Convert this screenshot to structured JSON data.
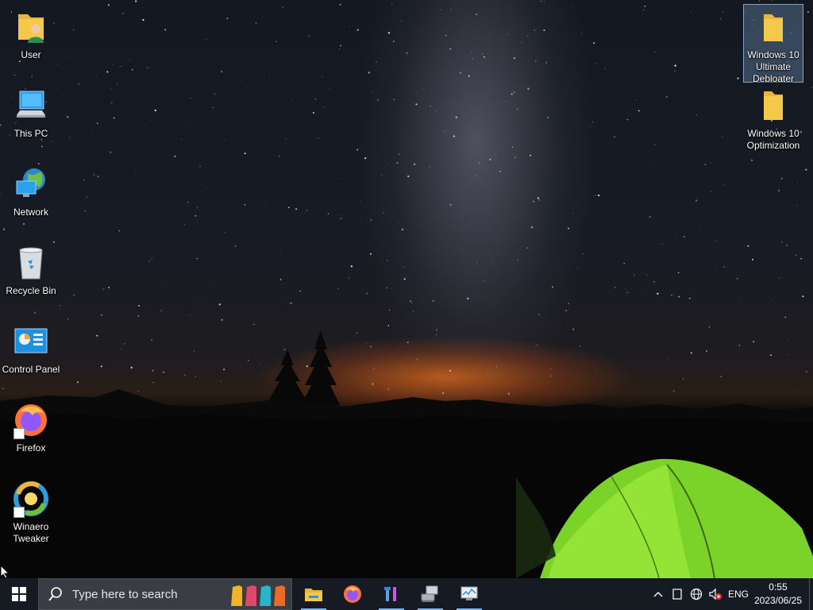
{
  "desktop": {
    "left_icons": [
      {
        "label": "User",
        "icon": "user-folder-icon"
      },
      {
        "label": "This PC",
        "icon": "computer-icon"
      },
      {
        "label": "Network",
        "icon": "network-globe-icon"
      },
      {
        "label": "Recycle Bin",
        "icon": "recycle-bin-icon"
      },
      {
        "label": "Control Panel",
        "icon": "control-panel-icon"
      },
      {
        "label": "Firefox",
        "icon": "firefox-icon"
      },
      {
        "label": "Winaero Tweaker",
        "icon": "winaero-tweaker-icon"
      }
    ],
    "right_icons": [
      {
        "label": "Windows 10 Ultimate Debloater",
        "icon": "folder-icon",
        "selected": true
      },
      {
        "label": "Windows 10 Optimization",
        "icon": "folder-icon",
        "selected": false
      }
    ]
  },
  "taskbar": {
    "start_icon": "windows-logo-icon",
    "search": {
      "placeholder": "Type here to search"
    },
    "pinned": [
      {
        "icon": "file-explorer-icon",
        "running": true
      },
      {
        "icon": "firefox-icon",
        "running": false
      },
      {
        "icon": "tools-icon",
        "running": true
      },
      {
        "icon": "network-computer-icon",
        "running": true
      },
      {
        "icon": "system-monitor-icon",
        "running": true
      }
    ],
    "tray": {
      "language": "ENG",
      "time": "0:55",
      "date": "2023/06/25"
    }
  },
  "colors": {
    "taskbar": "#161a22",
    "search_box": "#3a3d44",
    "running_indicator": "#7fb1e6",
    "folder": "#f4c94a"
  }
}
